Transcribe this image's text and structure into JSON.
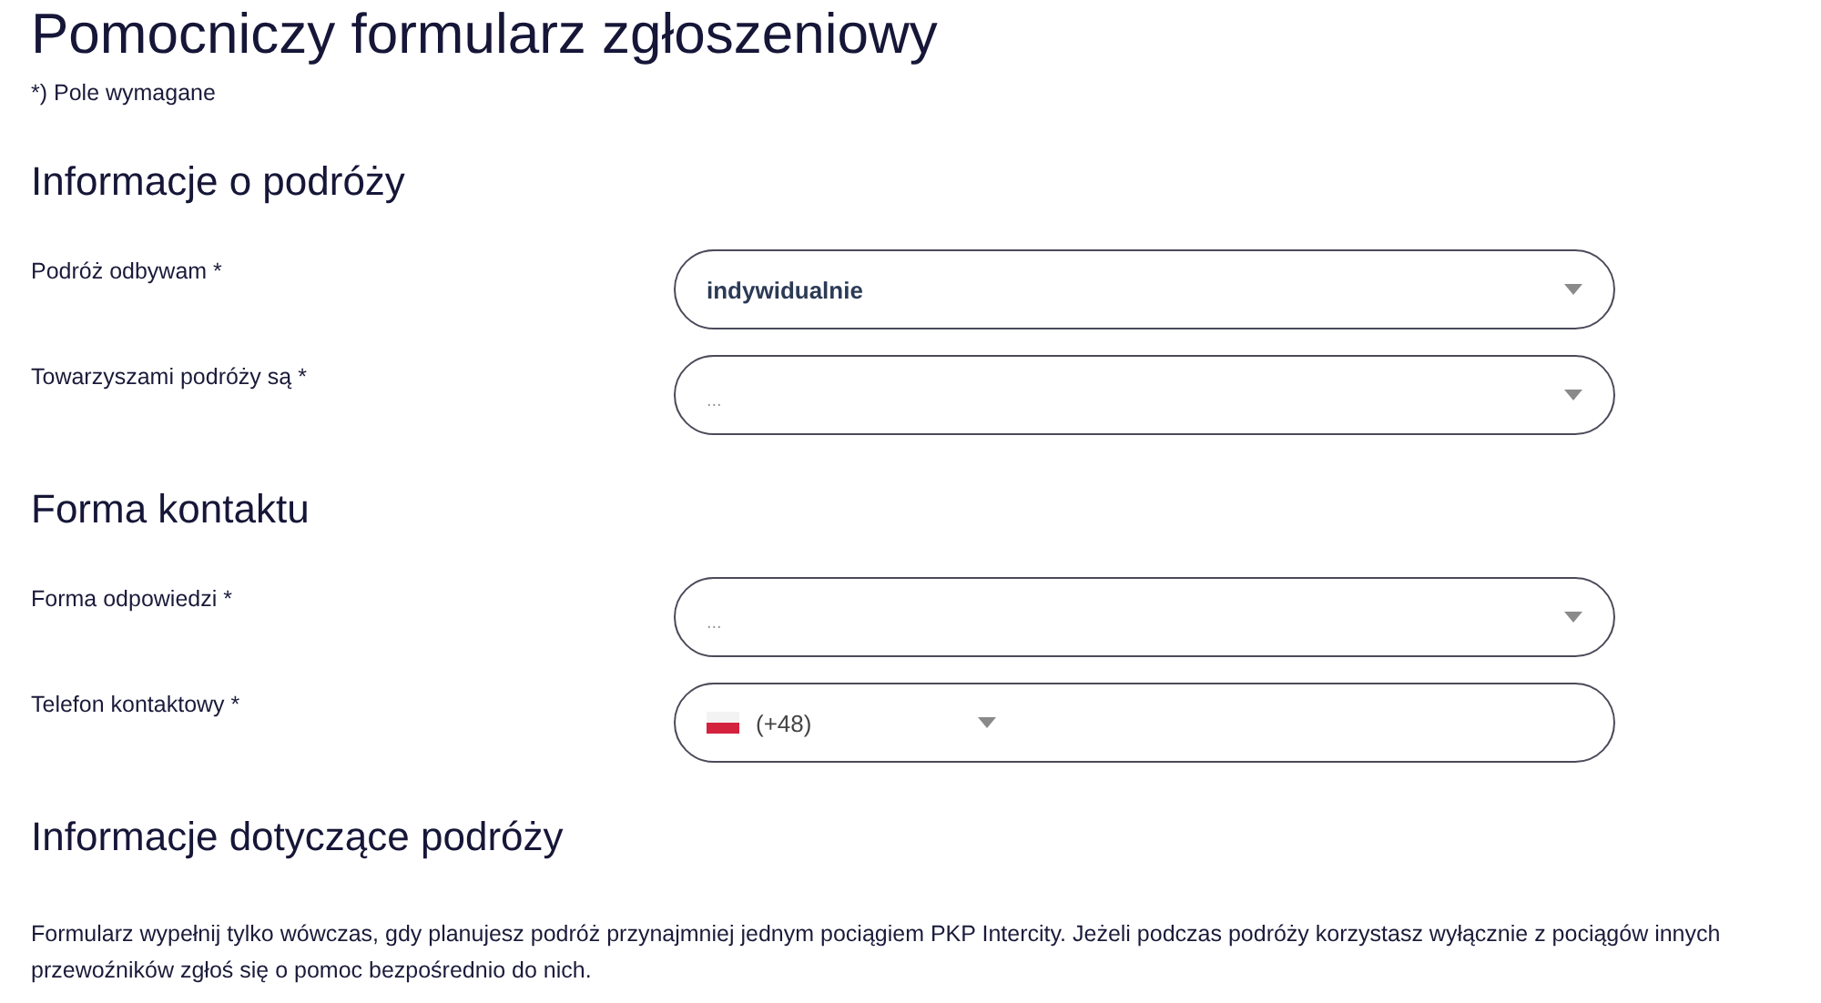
{
  "title": "Pomocniczy formularz zgłoszeniowy",
  "required_note": "*) Pole wymagane",
  "sections": [
    {
      "heading": "Informacje o podróży",
      "fields": [
        {
          "kind": "select",
          "label": "Podróż odbywam *",
          "value": "indywidualnie"
        },
        {
          "kind": "select",
          "label": "Towarzyszami podróży są *",
          "placeholder": "..."
        }
      ]
    },
    {
      "heading": "Forma kontaktu",
      "fields": [
        {
          "kind": "select",
          "label": "Forma odpowiedzi *",
          "placeholder": "..."
        },
        {
          "kind": "phone",
          "label": "Telefon kontaktowy *",
          "prefix": "(+48)"
        }
      ]
    },
    {
      "heading": "Informacje dotyczące podróży",
      "paragraph": "Formularz wypełnij tylko wówczas, gdy planujesz podróż przynajmniej jednym pociągiem PKP Intercity. Jeżeli podczas podróży korzystasz wyłącznie z pociągów innych przewoźników zgłoś się o pomoc bezpośrednio do nich."
    }
  ]
}
